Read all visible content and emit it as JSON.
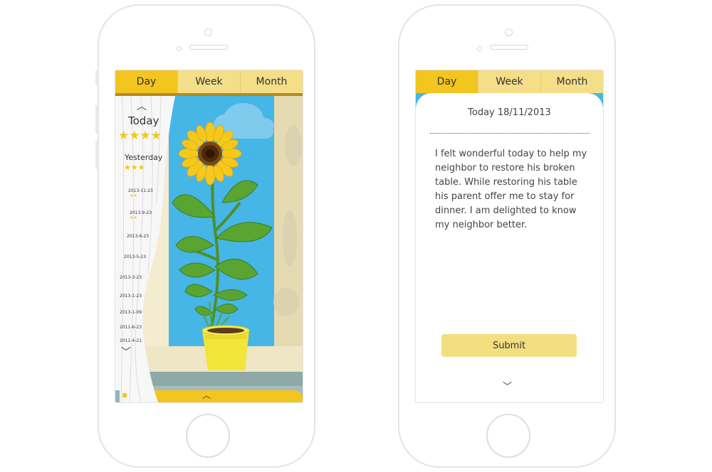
{
  "tabs": [
    "Day",
    "Week",
    "Month"
  ],
  "history": {
    "today_label": "Today",
    "today_stars": "★★★★",
    "yesterday_label": "Yesterday",
    "yesterday_stars": "★★★",
    "entries": [
      {
        "date": "2013-11-23",
        "stars": "★★"
      },
      {
        "date": "2013-9-23",
        "stars": "★★"
      },
      {
        "date": "2013-6-23",
        "stars": ""
      },
      {
        "date": "2013-5-23",
        "stars": ""
      },
      {
        "date": "2013-3-23",
        "stars": ""
      },
      {
        "date": "2013-1-23",
        "stars": ""
      },
      {
        "date": "2013-1-09",
        "stars": ""
      },
      {
        "date": "2011-6-23",
        "stars": ""
      },
      {
        "date": "2011-4-21",
        "stars": ""
      }
    ]
  },
  "diary": {
    "date": "Today 18/11/2013",
    "text": "I felt wonderful today to help my neighbor to restore his broken table. While restoring his table his parent offer me to stay for dinner. I am delighted to know my neighbor better.",
    "submit_label": "Submit"
  },
  "colors": {
    "accent": "#f3c51f",
    "tab_bg": "#f4de88",
    "sky": "#45b6e6",
    "submit_bg": "#f3de80"
  }
}
